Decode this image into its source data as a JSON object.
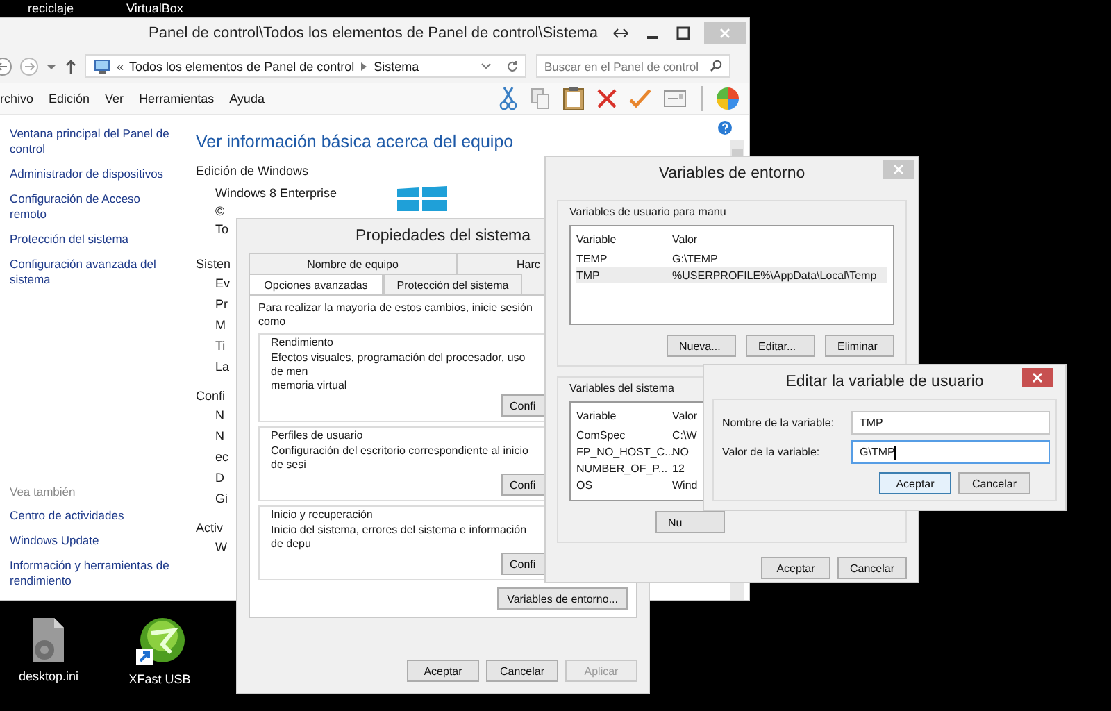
{
  "desktop": {
    "top_labels": [
      "reciclaje",
      "VirtualBox"
    ],
    "icons": [
      {
        "kind": "file",
        "label": "desktop.ini"
      },
      {
        "kind": "app",
        "label": "XFast USB"
      }
    ]
  },
  "control_panel": {
    "title": "Panel de control\\Todos los elementos de Panel de control\\Sistema",
    "active": false,
    "address": {
      "overflow": "«",
      "crumbs": [
        "Todos los elementos de Panel de control",
        "Sistema"
      ]
    },
    "search": {
      "placeholder": "Buscar en el Panel de control"
    },
    "menu": [
      "rchivo",
      "Edición",
      "Ver",
      "Herramientas",
      "Ayuda"
    ],
    "sidebar": {
      "links": [
        "Ventana principal del Panel de control",
        "Administrador de dispositivos",
        "Configuración de Acceso remoto",
        "Protección del sistema",
        "Configuración avanzada del sistema"
      ],
      "see_also_title": "Vea también",
      "see_also": [
        "Centro de actividades",
        "Windows Update",
        "Información y herramientas de rendimiento"
      ]
    },
    "heading": "Ver información básica acerca del equipo",
    "edition_title": "Edición de Windows",
    "edition": "Windows 8 Enterprise",
    "edition_lines": [
      "©",
      "To"
    ],
    "partial_lines": [
      {
        "kind": "section",
        "text": "Sisten"
      },
      {
        "kind": "item",
        "text": "Ev"
      },
      {
        "kind": "item",
        "text": "Pr"
      },
      {
        "kind": "item",
        "text": "M"
      },
      {
        "kind": "item",
        "text": "Ti"
      },
      {
        "kind": "item",
        "text": "La"
      },
      {
        "kind": "section",
        "text": "Confi"
      },
      {
        "kind": "item",
        "text": "N"
      },
      {
        "kind": "item",
        "text": "N"
      },
      {
        "kind": "item",
        "text": "ec"
      },
      {
        "kind": "item",
        "text": "D"
      },
      {
        "kind": "item",
        "text": "Gi"
      },
      {
        "kind": "section",
        "text": "Activ"
      },
      {
        "kind": "item",
        "text": "W"
      }
    ]
  },
  "system_properties": {
    "title": "Propiedades del sistema",
    "tabs_row1": [
      {
        "label": "Nombre de equipo",
        "selected": false
      },
      {
        "label": "Harc",
        "selected": false
      }
    ],
    "tabs_row2": [
      {
        "label": "Opciones avanzadas",
        "selected": true
      },
      {
        "label": "Protección del sistema",
        "selected": false
      }
    ],
    "intro": "Para realizar la mayoría de estos cambios, inicie sesión como",
    "groups": [
      {
        "title": "Rendimiento",
        "lines": [
          "Efectos visuales, programación del procesador, uso de men",
          "memoria virtual"
        ],
        "button": "Confi"
      },
      {
        "title": "Perfiles de usuario",
        "lines": [
          "Configuración del escritorio correspondiente al inicio de sesi"
        ],
        "button": "Confi"
      },
      {
        "title": "Inicio y recuperación",
        "lines": [
          "Inicio del sistema, errores del sistema e información de depu"
        ],
        "button": "Confi"
      }
    ],
    "env_button": "Variables de entorno...",
    "buttons": [
      {
        "label": "Aceptar",
        "disabled": false
      },
      {
        "label": "Cancelar",
        "disabled": false
      },
      {
        "label": "Aplicar",
        "disabled": true
      }
    ]
  },
  "environment_variables": {
    "title": "Variables de entorno",
    "active": false,
    "user_group": {
      "title": "Variables de usuario para manu",
      "columns": [
        "Variable",
        "Valor"
      ],
      "rows": [
        {
          "name": "TEMP",
          "value": "G:\\TEMP",
          "selected": false
        },
        {
          "name": "TMP",
          "value": "%USERPROFILE%\\AppData\\Local\\Temp",
          "selected": true
        }
      ],
      "buttons": [
        "Nueva...",
        "Editar...",
        "Eliminar"
      ]
    },
    "system_group": {
      "title": "Variables del sistema",
      "columns": [
        "Variable",
        "Valor"
      ],
      "rows": [
        {
          "name": "ComSpec",
          "value": "C:\\W",
          "selected": false
        },
        {
          "name": "FP_NO_HOST_C...",
          "value": "NO",
          "selected": false
        },
        {
          "name": "NUMBER_OF_P...",
          "value": "12",
          "selected": false
        },
        {
          "name": "OS",
          "value": "Wind",
          "selected": false
        }
      ],
      "buttons": [
        "Nu"
      ]
    },
    "buttons": [
      "Aceptar",
      "Cancelar"
    ]
  },
  "edit_dialog": {
    "title": "Editar la variable de usuario",
    "active": true,
    "fields": [
      {
        "label": "Nombre de la variable:",
        "value": "TMP",
        "focused": false
      },
      {
        "label": "Valor de la variable:",
        "value": "G\\TMP",
        "focused": true
      }
    ],
    "buttons": [
      {
        "label": "Aceptar",
        "default": true
      },
      {
        "label": "Cancelar",
        "default": false
      }
    ]
  }
}
